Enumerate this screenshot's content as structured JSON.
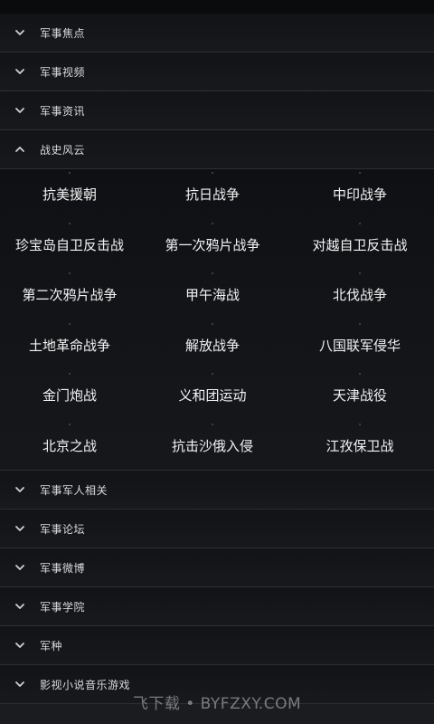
{
  "sections_top": [
    {
      "label": "军事焦点",
      "expanded": false
    },
    {
      "label": "军事视频",
      "expanded": false
    },
    {
      "label": "军事资讯",
      "expanded": false
    },
    {
      "label": "战史风云",
      "expanded": true
    }
  ],
  "expanded_items": [
    "抗美援朝",
    "抗日战争",
    "中印战争",
    "珍宝岛自卫反击战",
    "第一次鸦片战争",
    "对越自卫反击战",
    "第二次鸦片战争",
    "甲午海战",
    "北伐战争",
    "土地革命战争",
    "解放战争",
    "八国联军侵华",
    "金门炮战",
    "义和团运动",
    "天津战役",
    "北京之战",
    "抗击沙俄入侵",
    "江孜保卫战"
  ],
  "sections_bottom": [
    {
      "label": "军事军人相关",
      "expanded": false
    },
    {
      "label": "军事论坛",
      "expanded": false
    },
    {
      "label": "军事微博",
      "expanded": false
    },
    {
      "label": "军事学院",
      "expanded": false
    },
    {
      "label": "军种",
      "expanded": false
    },
    {
      "label": "影视小说音乐游戏",
      "expanded": false
    }
  ],
  "watermark": "飞下载 • BYFZXY.COM",
  "colors": {
    "background": "#0f1012",
    "divider": "#2c2f33",
    "text": "#f2f2f2"
  }
}
